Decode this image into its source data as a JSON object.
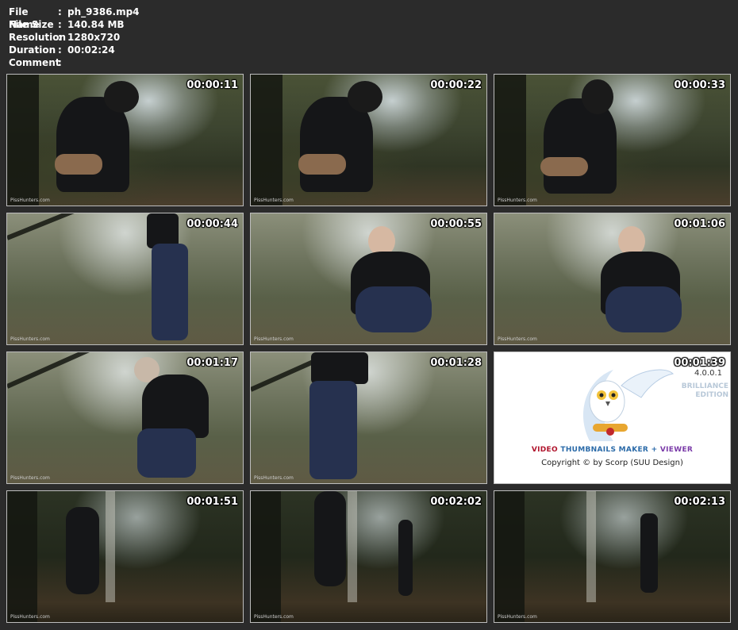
{
  "file_info": {
    "rows": [
      {
        "label": "File Name",
        "sep": ":",
        "value": "ph_9386.mp4"
      },
      {
        "label": "File Size",
        "sep": ":",
        "value": "140.84 MB"
      },
      {
        "label": "Resolution",
        "sep": ":",
        "value": "1280x720"
      },
      {
        "label": "Duration",
        "sep": ":",
        "value": "00:02:24"
      },
      {
        "label": "Comment",
        "sep": ":",
        "value": ""
      }
    ]
  },
  "thumbnails": [
    {
      "time": "00:00:11",
      "watermark": "PissHunters.com"
    },
    {
      "time": "00:00:22",
      "watermark": "PissHunters.com"
    },
    {
      "time": "00:00:33",
      "watermark": "PissHunters.com"
    },
    {
      "time": "00:00:44",
      "watermark": "PissHunters.com"
    },
    {
      "time": "00:00:55",
      "watermark": "PissHunters.com"
    },
    {
      "time": "00:01:06",
      "watermark": "PissHunters.com"
    },
    {
      "time": "00:01:17",
      "watermark": "PissHunters.com"
    },
    {
      "time": "00:01:28",
      "watermark": "PissHunters.com"
    },
    {
      "time": "00:01:39",
      "watermark": ""
    },
    {
      "time": "00:01:51",
      "watermark": "PissHunters.com"
    },
    {
      "time": "00:02:02",
      "watermark": "PissHunters.com"
    },
    {
      "time": "00:02:13",
      "watermark": "PissHunters.com"
    }
  ],
  "logo": {
    "version": "4.0.0.1",
    "edition_line1": "BRILLIANCE",
    "edition_line2": "EDITION",
    "brand_video": "VIDEO",
    "brand_thumbnails": "THUMBNAILS MAKER",
    "brand_plus": "+",
    "brand_viewer": "VIEWER",
    "copyright": "Copyright © by Scorp (SUU Design)"
  },
  "colors": {
    "background": "#2b2b2b",
    "text": "#ffffff",
    "border": "#bdbdbd",
    "brand_red": "#b0142c",
    "brand_blue": "#2a6aa8",
    "brand_purple": "#7a3aa8"
  }
}
